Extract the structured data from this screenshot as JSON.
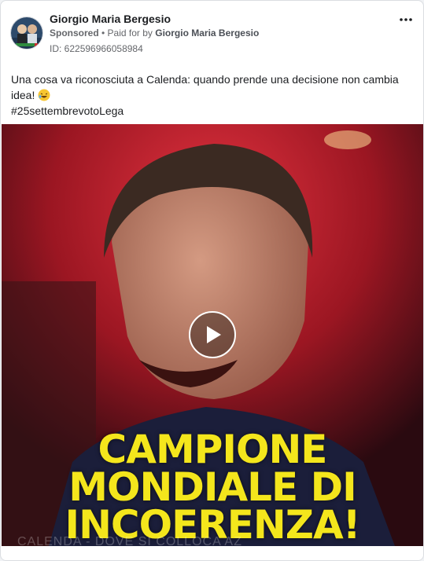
{
  "post": {
    "author": "Giorgio Maria Bergesio",
    "sponsored_label": "Sponsored",
    "separator": " • ",
    "paid_for_prefix": "Paid for by ",
    "payer": "Giorgio Maria Bergesio",
    "ad_id": "ID: 622596966058984",
    "more_icon": "more-options-icon",
    "text_line1": "Una cosa va riconosciuta a Calenda: quando prende una decisione non cambia idea! ",
    "emoji_icon": "laughing-face-emoji",
    "hashtag": "#25settembrevotoLega"
  },
  "video": {
    "play_icon": "play-icon",
    "caption_lines": [
      "CAMPIONE",
      "MONDIALE DI",
      "INCOERENZA!"
    ],
    "bottom_banner": "CALENDA - DOVE SI COLLOCA AZ"
  },
  "colors": {
    "caption_yellow": "#f4e61c",
    "background_red": "#c81c2a",
    "text_primary": "#1c1e21",
    "text_secondary": "#65676b"
  }
}
